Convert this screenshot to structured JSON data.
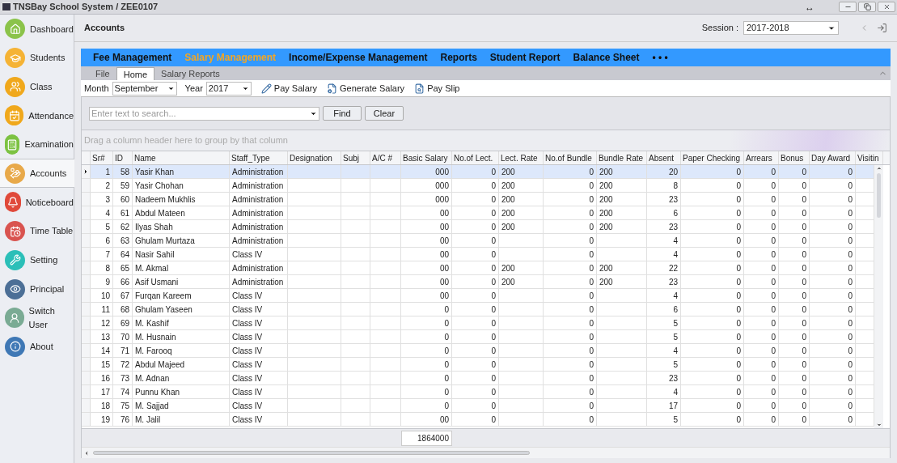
{
  "window": {
    "title": "TNSBay School System / ZEE0107",
    "resize_glyph": "↔"
  },
  "sidebar": {
    "items": [
      {
        "label": "Dashboard",
        "selected": false
      },
      {
        "label": "Students",
        "selected": false
      },
      {
        "label": "Class",
        "selected": false
      },
      {
        "label": "Attendance",
        "selected": false
      },
      {
        "label": "Examination",
        "selected": false
      },
      {
        "label": "Accounts",
        "selected": true
      },
      {
        "label": "Noticeboard",
        "selected": false
      },
      {
        "label": "Time Table",
        "selected": false
      },
      {
        "label": "Setting",
        "selected": false
      },
      {
        "label": "Principal",
        "selected": false
      },
      {
        "label": "Switch User",
        "selected": false
      },
      {
        "label": "About",
        "selected": false
      }
    ]
  },
  "header": {
    "title": "Accounts",
    "session_label": "Session :",
    "session_value": "2017-2018"
  },
  "menu": [
    {
      "label": "Fee Management",
      "selected": false
    },
    {
      "label": "Salary Management",
      "selected": true
    },
    {
      "label": "Income/Expense Management",
      "selected": false
    },
    {
      "label": "Reports",
      "selected": false
    },
    {
      "label": "Student Report",
      "selected": false
    },
    {
      "label": "Balance Sheet",
      "selected": false
    },
    {
      "label": "• • •",
      "selected": false
    }
  ],
  "ribbon_tabs": [
    {
      "label": "File",
      "selected": false
    },
    {
      "label": "Home",
      "selected": true
    },
    {
      "label": "Salary Reports",
      "selected": false
    }
  ],
  "toolbar": {
    "month_label": "Month",
    "month_value": "September",
    "year_label": "Year",
    "year_value": "2017",
    "buttons": [
      "Pay Salary",
      "Generate Salary",
      "Pay Slip"
    ]
  },
  "search": {
    "placeholder": "Enter text to search...",
    "find": "Find",
    "clear": "Clear"
  },
  "group_panel": {
    "hint": "Drag a column header here to group by that column"
  },
  "table": {
    "columns": [
      "Sr#",
      "ID",
      "Name",
      "Staff_Type",
      "Designation",
      "Subj",
      "A/C #",
      "Basic Salary",
      "No.of Lect.",
      "Lect. Rate",
      "No.of Bundle",
      "Bundle Rate",
      "Absent",
      "Paper Checking",
      "Arrears",
      "Bonus",
      "Day Award",
      "Visitin"
    ],
    "rows": [
      {
        "selected": true,
        "cells": [
          "1",
          "58",
          "Yasir Khan",
          "Administration",
          null,
          null,
          null,
          "000",
          "0",
          "200",
          "0",
          "200",
          "20",
          "0",
          "0",
          "0",
          "0",
          null
        ]
      },
      {
        "selected": false,
        "cells": [
          "2",
          "59",
          "Yasir Chohan",
          "Administration",
          null,
          null,
          null,
          "000",
          "0",
          "200",
          "0",
          "200",
          "8",
          "0",
          "0",
          "0",
          "0",
          null
        ]
      },
      {
        "selected": false,
        "cells": [
          "3",
          "60",
          "Nadeem Mukhlis",
          "Administration",
          null,
          null,
          null,
          "000",
          "0",
          "200",
          "0",
          "200",
          "23",
          "0",
          "0",
          "0",
          "0",
          null
        ]
      },
      {
        "selected": false,
        "cells": [
          "4",
          "61",
          "Abdul Mateen",
          "Administration",
          null,
          null,
          null,
          "00",
          "0",
          "200",
          "0",
          "200",
          "6",
          "0",
          "0",
          "0",
          "0",
          null
        ]
      },
      {
        "selected": false,
        "cells": [
          "5",
          "62",
          "Ilyas Shah",
          "Administration",
          null,
          null,
          null,
          "00",
          "0",
          "200",
          "0",
          "200",
          "23",
          "0",
          "0",
          "0",
          "0",
          null
        ]
      },
      {
        "selected": false,
        "cells": [
          "6",
          "63",
          "Ghulam Murtaza",
          "Administration",
          null,
          null,
          null,
          "00",
          "0",
          null,
          "0",
          null,
          "4",
          "0",
          "0",
          "0",
          "0",
          null
        ]
      },
      {
        "selected": false,
        "cells": [
          "7",
          "64",
          "Nasir Sahil",
          "Class IV",
          null,
          null,
          null,
          "00",
          "0",
          null,
          "0",
          null,
          "4",
          "0",
          "0",
          "0",
          "0",
          null
        ]
      },
      {
        "selected": false,
        "cells": [
          "8",
          "65",
          "M. Akmal",
          "Administration",
          null,
          null,
          null,
          "00",
          "0",
          "200",
          "0",
          "200",
          "22",
          "0",
          "0",
          "0",
          "0",
          null
        ]
      },
      {
        "selected": false,
        "cells": [
          "9",
          "66",
          "Asif Usmani",
          "Administration",
          null,
          null,
          null,
          "00",
          "0",
          "200",
          "0",
          "200",
          "23",
          "0",
          "0",
          "0",
          "0",
          null
        ]
      },
      {
        "selected": false,
        "cells": [
          "10",
          "67",
          "Furqan Kareem",
          "Class IV",
          null,
          null,
          null,
          "00",
          "0",
          null,
          "0",
          null,
          "4",
          "0",
          "0",
          "0",
          "0",
          null
        ]
      },
      {
        "selected": false,
        "cells": [
          "11",
          "68",
          "Ghulam Yaseen",
          "Class IV",
          null,
          null,
          null,
          "0",
          "0",
          null,
          "0",
          null,
          "6",
          "0",
          "0",
          "0",
          "0",
          null
        ]
      },
      {
        "selected": false,
        "cells": [
          "12",
          "69",
          "M. Kashif",
          "Class IV",
          null,
          null,
          null,
          "0",
          "0",
          null,
          "0",
          null,
          "5",
          "0",
          "0",
          "0",
          "0",
          null
        ]
      },
      {
        "selected": false,
        "cells": [
          "13",
          "70",
          "M. Husnain",
          "Class IV",
          null,
          null,
          null,
          "0",
          "0",
          null,
          "0",
          null,
          "5",
          "0",
          "0",
          "0",
          "0",
          null
        ]
      },
      {
        "selected": false,
        "cells": [
          "14",
          "71",
          "M. Farooq",
          "Class IV",
          null,
          null,
          null,
          "0",
          "0",
          null,
          "0",
          null,
          "4",
          "0",
          "0",
          "0",
          "0",
          null
        ]
      },
      {
        "selected": false,
        "cells": [
          "15",
          "72",
          "Abdul Majeed",
          "Class IV",
          null,
          null,
          null,
          "0",
          "0",
          null,
          "0",
          null,
          "5",
          "0",
          "0",
          "0",
          "0",
          null
        ]
      },
      {
        "selected": false,
        "cells": [
          "16",
          "73",
          "M. Adnan",
          "Class IV",
          null,
          null,
          null,
          "0",
          "0",
          null,
          "0",
          null,
          "23",
          "0",
          "0",
          "0",
          "0",
          null
        ]
      },
      {
        "selected": false,
        "cells": [
          "17",
          "74",
          "Punnu Khan",
          "Class IV",
          null,
          null,
          null,
          "0",
          "0",
          null,
          "0",
          null,
          "4",
          "0",
          "0",
          "0",
          "0",
          null
        ]
      },
      {
        "selected": false,
        "cells": [
          "18",
          "75",
          "M. Sajjad",
          "Class IV",
          null,
          null,
          null,
          "0",
          "0",
          null,
          "0",
          null,
          "17",
          "0",
          "0",
          "0",
          "0",
          null
        ]
      },
      {
        "selected": false,
        "cells": [
          "19",
          "76",
          "M. Jalil",
          "Class IV",
          null,
          null,
          null,
          "00",
          "0",
          null,
          "0",
          null,
          "5",
          "0",
          "0",
          "0",
          "0",
          null
        ]
      }
    ],
    "total": "1864000"
  }
}
